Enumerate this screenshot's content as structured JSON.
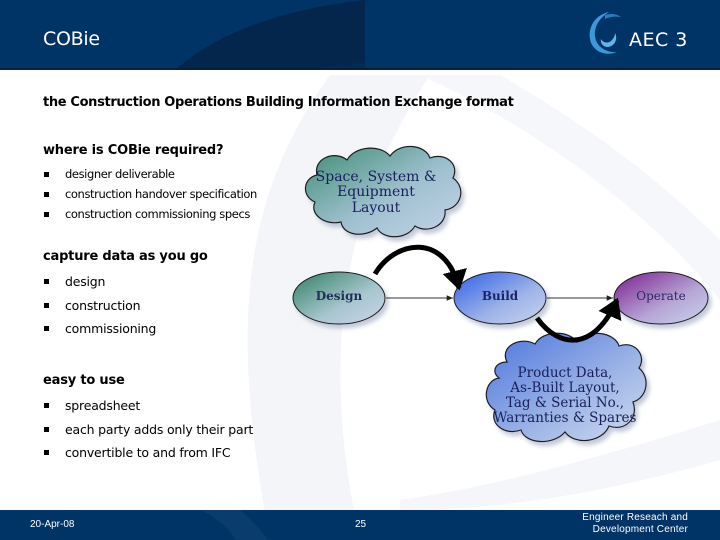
{
  "header": {
    "title": "COBie",
    "logo": {
      "text": "AEC 3",
      "icon": "swirl-logo-icon"
    }
  },
  "subtitle": "the Construction Operations Building Information Exchange format",
  "sections": [
    {
      "heading": "where is COBie required?",
      "items": [
        "designer deliverable",
        "construction handover specification",
        "construction commissioning specs"
      ]
    },
    {
      "heading": "capture data as you go",
      "items": [
        "design",
        "construction",
        "commissioning"
      ]
    },
    {
      "heading": "easy to use",
      "items": [
        "spreadsheet",
        "each party adds only their part",
        "convertible to and from IFC"
      ]
    }
  ],
  "diagram": {
    "clouds": {
      "top": "Space, System & Equipment Layout",
      "top_lines": [
        "Space, System &",
        "Equipment",
        "Layout"
      ],
      "bottom": "Product Data, As-Built Layout, Tag & Serial No., Warranties & Spares",
      "bottom_lines": [
        "Product Data,",
        "As-Built Layout,",
        "Tag & Serial No.,",
        "Warranties & Spares"
      ]
    },
    "stages": [
      {
        "label": "Design",
        "color": "#3f8f78"
      },
      {
        "label": "Build",
        "color": "#3f6fe0"
      },
      {
        "label": "Operate",
        "color": "#8a2a9a"
      }
    ],
    "flows": [
      {
        "from": "Design",
        "to": "Build",
        "style": "thin"
      },
      {
        "from": "Build",
        "to": "Operate",
        "style": "thin"
      },
      {
        "from": "Design",
        "to": "Build",
        "via": "Space, System & Equipment Layout",
        "style": "thick-arc"
      },
      {
        "from": "Build",
        "to": "Operate",
        "via": "Product Data",
        "style": "thick-arc"
      }
    ]
  },
  "footer": {
    "date": "20-Apr-08",
    "page": "25",
    "org_line1": "Engineer Reseach and",
    "org_line2": "Development Center"
  },
  "colors": {
    "header_bg": "#013466",
    "footer_bg": "#013466",
    "logo_accent": "#3a9ad9"
  }
}
